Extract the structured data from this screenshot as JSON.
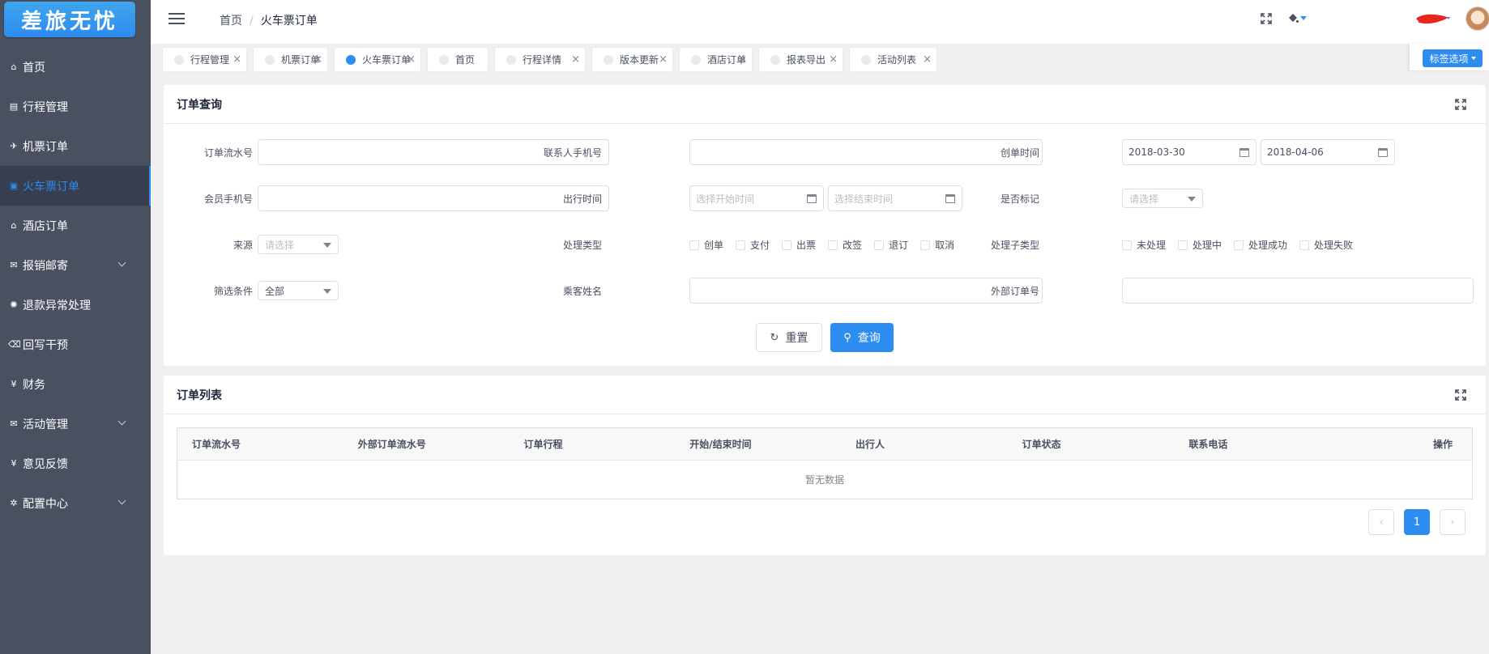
{
  "app": {
    "logo_text": "差旅无忧"
  },
  "sidebar": {
    "items": [
      {
        "label": "首页",
        "icon": "home-icon",
        "glyph": "⌂"
      },
      {
        "label": "行程管理",
        "icon": "document-icon",
        "glyph": "▤"
      },
      {
        "label": "机票订单",
        "icon": "plane-icon",
        "glyph": "✈"
      },
      {
        "label": "火车票订单",
        "icon": "train-icon",
        "glyph": "▣"
      },
      {
        "label": "酒店订单",
        "icon": "home-icon",
        "glyph": "⌂"
      },
      {
        "label": "报销邮寄",
        "icon": "mail-icon",
        "glyph": "✉"
      },
      {
        "label": "退款异常处理",
        "icon": "bug-icon",
        "glyph": "✺"
      },
      {
        "label": "回写干预",
        "icon": "backspace-icon",
        "glyph": "⌫"
      },
      {
        "label": "财务",
        "icon": "yen-icon",
        "glyph": "¥"
      },
      {
        "label": "活动管理",
        "icon": "mail-icon",
        "glyph": "✉"
      },
      {
        "label": "意见反馈",
        "icon": "yen-icon",
        "glyph": "¥"
      },
      {
        "label": "配置中心",
        "icon": "gear-icon",
        "glyph": "✲"
      }
    ],
    "active_index": 3
  },
  "header": {
    "breadcrumb": [
      "首页",
      "火车票订单"
    ],
    "separator": "/"
  },
  "tabs": {
    "items": [
      "行程管理",
      "机票订单",
      "火车票订单",
      "首页",
      "行程详情",
      "版本更新",
      "酒店订单",
      "报表导出",
      "活动列表"
    ],
    "active_index": 2,
    "options_label": "标签选项"
  },
  "query": {
    "title": "订单查询",
    "fields": {
      "order_no": {
        "label": "订单流水号",
        "value": ""
      },
      "contact_phone": {
        "label": "联系人手机号",
        "value": ""
      },
      "create_time": {
        "label": "创单时间",
        "start": "2018-03-30",
        "end": "2018-04-06"
      },
      "member_phone": {
        "label": "会员手机号",
        "value": ""
      },
      "travel_time": {
        "label": "出行时间",
        "start_placeholder": "选择开始时间",
        "end_placeholder": "选择结束时间"
      },
      "mark": {
        "label": "是否标记",
        "placeholder": "请选择"
      },
      "source": {
        "label": "来源",
        "placeholder": "请选择"
      },
      "process_type": {
        "label": "处理类型",
        "options": [
          "创单",
          "支付",
          "出票",
          "改签",
          "退订",
          "取消"
        ]
      },
      "process_subtype": {
        "label": "处理子类型",
        "options": [
          "未处理",
          "处理中",
          "处理成功",
          "处理失败"
        ]
      },
      "filter": {
        "label": "筛选条件",
        "value": "全部"
      },
      "passenger": {
        "label": "乘客姓名",
        "value": ""
      },
      "external_no": {
        "label": "外部订单号",
        "value": ""
      }
    },
    "reset_label": "重置",
    "query_label": "查询"
  },
  "orders": {
    "title": "订单列表",
    "columns": [
      "订单流水号",
      "外部订单流水号",
      "订单行程",
      "开始/结束时间",
      "出行人",
      "订单状态",
      "联系电话",
      "操作"
    ],
    "empty_text": "暂无数据",
    "current_page": "1"
  }
}
